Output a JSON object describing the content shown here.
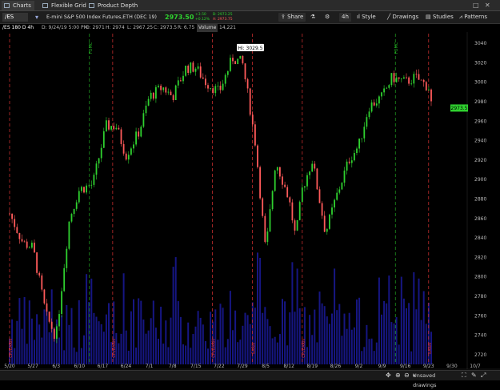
{
  "tabs": [
    {
      "label": "Charts",
      "icon": "chart-icon"
    },
    {
      "label": "Flexible Grid",
      "icon": "grid-icon"
    },
    {
      "label": "Product Depth",
      "icon": "depth-icon"
    }
  ],
  "toolbar": {
    "symbol": "/ES",
    "description": "E-mini S&P 500 Index Futures,ETH (DEC 19)",
    "last_price": "2973.50",
    "change_up": "+3.50",
    "change_pct": "+0.12%",
    "bid": "B: 2973.25",
    "ask": "A: 2973.75",
    "share_label": "Share",
    "timeframe_label": "4h",
    "style_label": "Style",
    "drawings_label": "Drawings",
    "studies_label": "Studies",
    "patterns_label": "Patterns"
  },
  "infobar": {
    "symbol_tf": "/ES 180 D 4h",
    "datetime": "D: 9/24/19 5:00 PM",
    "open": "O: 2971",
    "high": "H: 2974",
    "low": "L: 2967.25",
    "close": "C: 2973.5",
    "range": "R: 6.75",
    "volume_label": "Volume",
    "volume_value": "14,221"
  },
  "chart_data": {
    "type": "candlestick",
    "hi_label": "Hi: 3029.5",
    "last_label": "2973.5",
    "ylim": [
      2710,
      3050
    ],
    "y_ticks": [
      3040,
      3020,
      3000,
      2980,
      2960,
      2940,
      2920,
      2900,
      2880,
      2860,
      2840,
      2820,
      2800,
      2780,
      2760,
      2740,
      2720
    ],
    "x_ticks": [
      "5/20",
      "5/27",
      "6/3",
      "6/10",
      "6/17",
      "6/24",
      "7/1",
      "7/8",
      "7/15",
      "7/22",
      "7/29",
      "8/5",
      "8/12",
      "8/19",
      "8/26",
      "9/2",
      "9/9",
      "9/16",
      "9/23",
      "9/30",
      "10/7"
    ],
    "series": [
      {
        "x": "5/20",
        "close": 2865
      },
      {
        "x": "5/24",
        "close": 2835
      },
      {
        "x": "5/27",
        "close": 2830
      },
      {
        "x": "5/31",
        "close": 2760
      },
      {
        "x": "6/3",
        "close": 2738
      },
      {
        "x": "6/5",
        "close": 2800
      },
      {
        "x": "6/7",
        "close": 2860
      },
      {
        "x": "6/10",
        "close": 2890
      },
      {
        "x": "6/14",
        "close": 2895
      },
      {
        "x": "6/18",
        "close": 2955
      },
      {
        "x": "6/21",
        "close": 2955
      },
      {
        "x": "6/24",
        "close": 2925
      },
      {
        "x": "6/28",
        "close": 2950
      },
      {
        "x": "7/1",
        "close": 2985
      },
      {
        "x": "7/5",
        "close": 2995
      },
      {
        "x": "7/8",
        "close": 2985
      },
      {
        "x": "7/12",
        "close": 3015
      },
      {
        "x": "7/15",
        "close": 3015
      },
      {
        "x": "7/18",
        "close": 3000
      },
      {
        "x": "7/22",
        "close": 2990
      },
      {
        "x": "7/26",
        "close": 3025
      },
      {
        "x": "7/29",
        "close": 3020
      },
      {
        "x": "7/31",
        "close": 2980
      },
      {
        "x": "8/2",
        "close": 2935
      },
      {
        "x": "8/5",
        "close": 2825
      },
      {
        "x": "8/8",
        "close": 2920
      },
      {
        "x": "8/12",
        "close": 2880
      },
      {
        "x": "8/14",
        "close": 2840
      },
      {
        "x": "8/16",
        "close": 2890
      },
      {
        "x": "8/19",
        "close": 2920
      },
      {
        "x": "8/23",
        "close": 2845
      },
      {
        "x": "8/26",
        "close": 2880
      },
      {
        "x": "8/30",
        "close": 2920
      },
      {
        "x": "9/2",
        "close": 2935
      },
      {
        "x": "9/5",
        "close": 2975
      },
      {
        "x": "9/9",
        "close": 2985
      },
      {
        "x": "9/12",
        "close": 3005
      },
      {
        "x": "9/16",
        "close": 3000
      },
      {
        "x": "9/19",
        "close": 3005
      },
      {
        "x": "9/23",
        "close": 2995
      },
      {
        "x": "9/24",
        "close": 2973.5
      }
    ],
    "vertical_markers": [
      {
        "label": "CPI/EARN",
        "color": "#d33",
        "x": "5/20"
      },
      {
        "label": "FOMC",
        "color": "#2a2",
        "x": "6/13"
      },
      {
        "label": "CPI/EARN",
        "color": "#d33",
        "x": "6/20"
      },
      {
        "label": "CPI/EARN",
        "color": "#d33",
        "x": "7/20"
      },
      {
        "label": "EARN",
        "color": "#d33",
        "x": "8/1"
      },
      {
        "label": "CPI/EARN",
        "color": "#d33",
        "x": "8/16"
      },
      {
        "label": "FOMC",
        "color": "#2a2",
        "x": "9/13"
      },
      {
        "label": "EARN",
        "color": "#d33",
        "x": "9/23"
      }
    ],
    "colors": {
      "up": "#2fd12f",
      "down": "#ff5a5a",
      "volume": "#1a1a9a",
      "bg": "#000000"
    }
  },
  "footer": {
    "unsaved_label": "Unsaved drawings"
  }
}
